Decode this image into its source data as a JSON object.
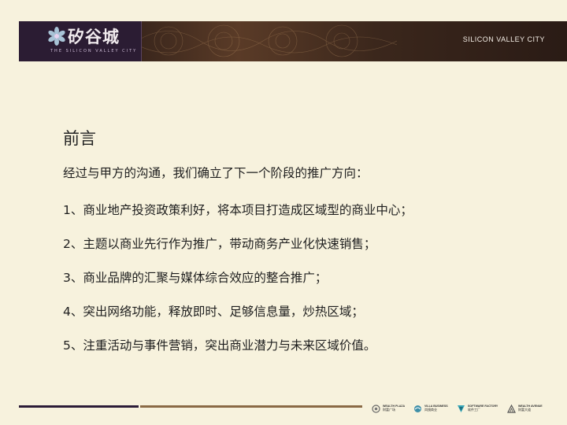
{
  "header": {
    "logo_cn": "矽谷城",
    "logo_en": "THE SILICON VALLEY CITY",
    "title": "SILICON VALLEY CITY"
  },
  "content": {
    "heading": "前言",
    "intro": "经过与甲方的沟通，我们确立了下一个阶段的推广方向：",
    "items": [
      "1、商业地产投资政策利好，将本项目打造成区域型的商业中心；",
      "2、主题以商业先行作为推广，带动商务产业化快速销售；",
      "3、商业品牌的汇聚与媒体综合效应的整合推广；",
      "4、突出网络功能，释放即时、足够信息量，炒热区域；",
      "5、注重活动与事件营销，突出商业潜力与未来区域价值。"
    ]
  },
  "footer": {
    "brands": [
      {
        "en": "WEALTH PLAZA",
        "cn": "财富广场"
      },
      {
        "en": "VILLA BUSINESS",
        "cn": "岚镜商业"
      },
      {
        "en": "SOFTWARE FACTORY",
        "cn": "软件工厂"
      },
      {
        "en": "WEALTH AVENUE",
        "cn": "财富大道"
      }
    ]
  },
  "colors": {
    "background": "#f7f2dd",
    "header_dark": "#2a1b15",
    "logo_purple": "#2b1c33",
    "accent_brown": "#8a6a45"
  }
}
